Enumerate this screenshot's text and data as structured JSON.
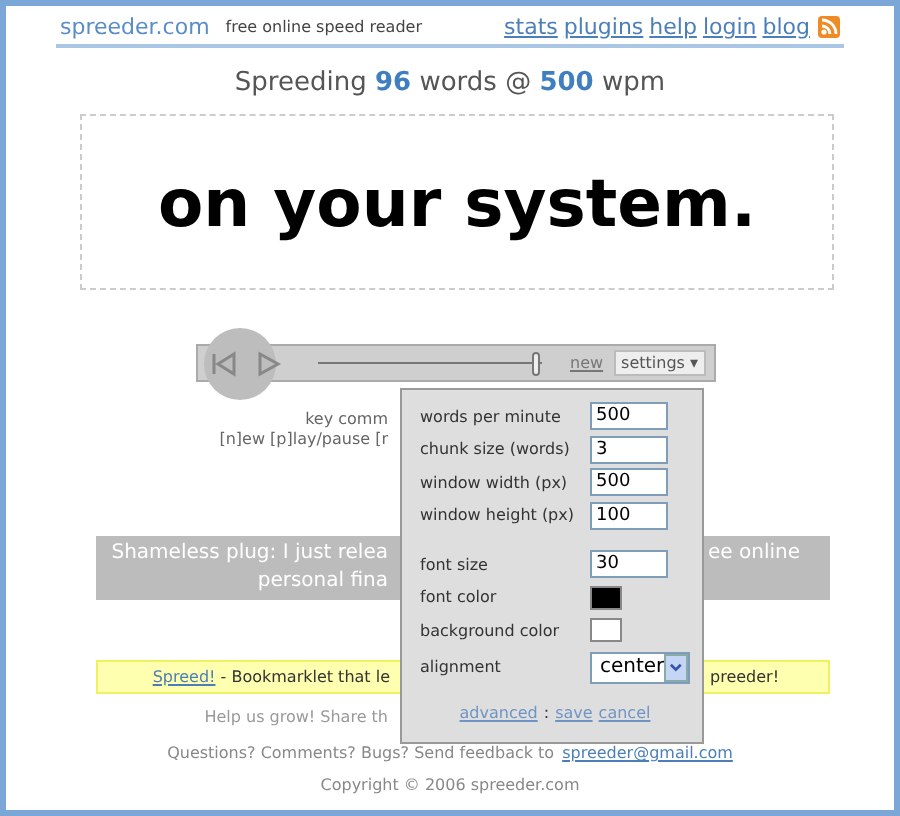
{
  "header": {
    "logo": "spreeder.com",
    "tagline": "free online speed reader",
    "links": [
      "stats",
      "plugins",
      "help",
      "login",
      "blog"
    ]
  },
  "status": {
    "prefix": "Spreeding",
    "count": "96",
    "middle": "words @",
    "wpm": "500",
    "suffix": "wpm"
  },
  "reader": {
    "text": "on your system."
  },
  "controls": {
    "level": 0.97,
    "new_label": "new",
    "settings_label": "settings ▾",
    "settings_expanded": true
  },
  "key_commands": {
    "line_1": "key comm",
    "line_2": "[n]ew [p]lay/pause [r"
  },
  "plug": {
    "line_1_left": "Shameless plug: I just relea",
    "line_1_right": "ee online",
    "line_2_left": "personal fina"
  },
  "bookmarklet": {
    "link": "Spreed!",
    "left": " - Bookmarklet that le",
    "right": "preeder!"
  },
  "help": "Help us grow! Share th",
  "feedback": {
    "text": "Questions? Comments? Bugs? Send feedback to",
    "email": "spreeder@gmail.com"
  },
  "copyright": "Copyright © 2006 spreeder.com",
  "settings": {
    "fields": [
      {
        "kind": "input",
        "label": "words per minute",
        "value": "500"
      },
      {
        "kind": "input",
        "label": "chunk size (words)",
        "value": "3"
      },
      {
        "kind": "input",
        "label": "window width (px)",
        "value": "500"
      },
      {
        "kind": "input",
        "label": "window height (px)",
        "value": "100"
      },
      {
        "kind": "spacer"
      },
      {
        "kind": "input",
        "label": "font size",
        "value": "30"
      },
      {
        "kind": "swatch",
        "label": "font color",
        "color": "#000000"
      },
      {
        "kind": "swatch",
        "label": "background color",
        "color": "#ffffff"
      },
      {
        "kind": "select",
        "label": "alignment",
        "value": "center"
      }
    ],
    "links": [
      "advanced",
      ":",
      "save",
      "cancel"
    ]
  }
}
